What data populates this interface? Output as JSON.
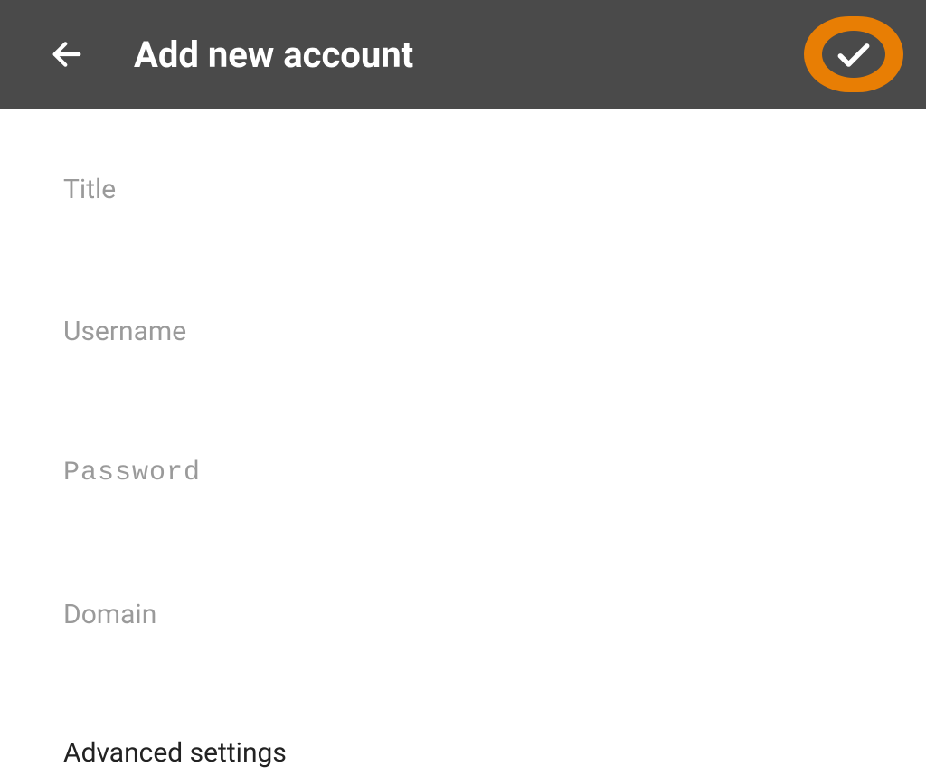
{
  "header": {
    "title": "Add new account"
  },
  "fields": {
    "title": {
      "placeholder": "Title",
      "value": ""
    },
    "username": {
      "placeholder": "Username",
      "value": ""
    },
    "password": {
      "placeholder": "Password",
      "value": ""
    },
    "domain": {
      "placeholder": "Domain",
      "value": ""
    }
  },
  "advanced": {
    "label": "Advanced settings"
  },
  "colors": {
    "header_bg": "#4a4a4a",
    "accent": "#e87e04",
    "placeholder": "#9a9a9a",
    "text": "#222222"
  }
}
